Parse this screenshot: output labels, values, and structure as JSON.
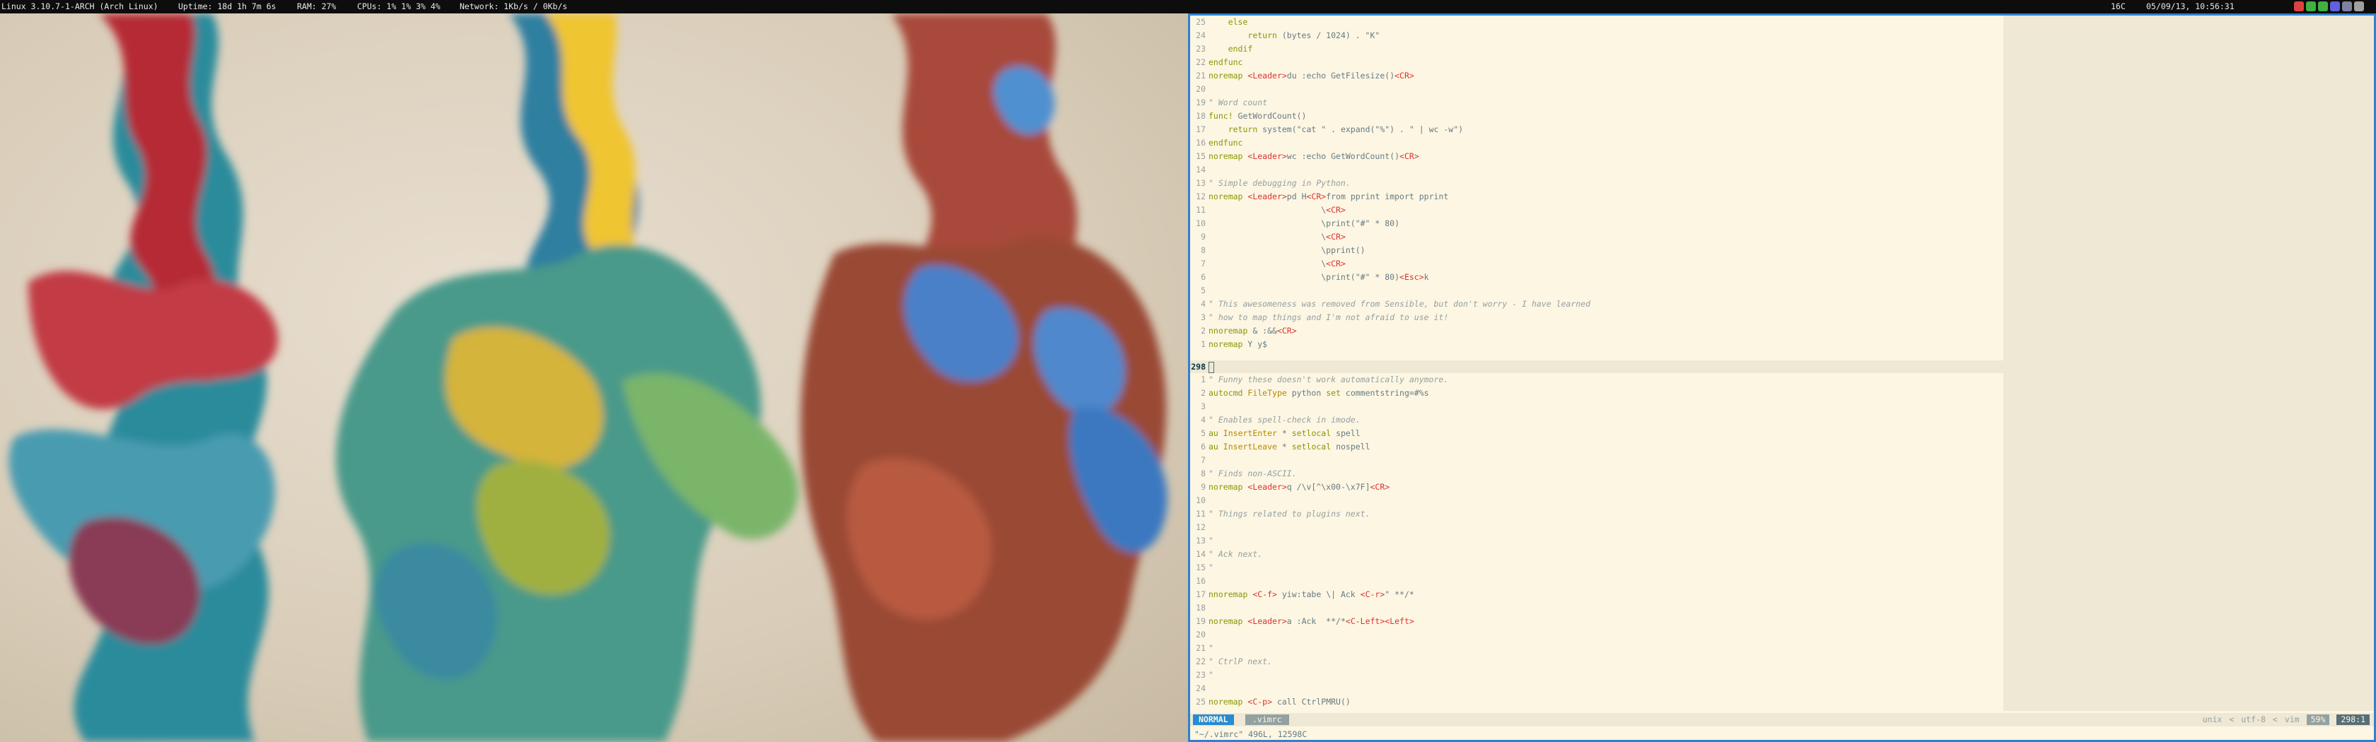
{
  "topbar": {
    "kernel": "Linux 3.10.7-1-ARCH (Arch Linux)",
    "uptime": "Uptime: 18d 1h 7m 6s",
    "ram": "RAM: 27%",
    "cpus": "CPUs: 1% 1% 3% 4%",
    "network": "Network: 1Kb/s / 0Kb/s",
    "temperature": "16C",
    "datetime": "05/09/13, 10:56:31",
    "tray_colors": [
      "#e04040",
      "#40b040",
      "#40b040",
      "#6060e0",
      "#8080a0",
      "#a0a0a0"
    ]
  },
  "editor": {
    "top_lines": [
      {
        "n": "25",
        "text": "    else"
      },
      {
        "n": "24",
        "text": "        return (bytes / 1024) . \"K\""
      },
      {
        "n": "23",
        "text": "    endif"
      },
      {
        "n": "22",
        "text": "endfunc"
      },
      {
        "n": "21",
        "text": "noremap <Leader>du :echo GetFilesize()<CR>"
      },
      {
        "n": "20",
        "text": ""
      },
      {
        "n": "19",
        "text": "\" Word count"
      },
      {
        "n": "18",
        "text": "func! GetWordCount()"
      },
      {
        "n": "17",
        "text": "    return system(\"cat \" . expand(\"%\") . \" | wc -w\")"
      },
      {
        "n": "16",
        "text": "endfunc"
      },
      {
        "n": "15",
        "text": "noremap <Leader>wc :echo GetWordCount()<CR>"
      },
      {
        "n": "14",
        "text": ""
      },
      {
        "n": "13",
        "text": "\" Simple debugging in Python."
      },
      {
        "n": "12",
        "text": "noremap <Leader>pd H<CR>from pprint import pprint"
      },
      {
        "n": "11",
        "text": "                       \\<CR>"
      },
      {
        "n": "10",
        "text": "                       \\print(\"#\" * 80)"
      },
      {
        "n": "9",
        "text": "                       \\<CR>"
      },
      {
        "n": "8",
        "text": "                       \\pprint()"
      },
      {
        "n": "7",
        "text": "                       \\<CR>"
      },
      {
        "n": "6",
        "text": "                       \\print(\"#\" * 80)<Esc>k"
      },
      {
        "n": "5",
        "text": ""
      },
      {
        "n": "4",
        "text": "\" This awesomeness was removed from Sensible, but don't worry - I have learned"
      },
      {
        "n": "3",
        "text": "\" how to map things and I'm not afraid to use it!"
      },
      {
        "n": "2",
        "text": "nnoremap & :&&<CR>"
      },
      {
        "n": "1",
        "text": "noremap Y y$"
      }
    ],
    "current_line_number": "298",
    "bottom_lines": [
      {
        "n": "1",
        "text": "\" Funny these doesn't work automatically anymore."
      },
      {
        "n": "2",
        "text": "autocmd FileType python set commentstring=#%s"
      },
      {
        "n": "3",
        "text": ""
      },
      {
        "n": "4",
        "text": "\" Enables spell-check in imode."
      },
      {
        "n": "5",
        "text": "au InsertEnter * setlocal spell"
      },
      {
        "n": "6",
        "text": "au InsertLeave * setlocal nospell"
      },
      {
        "n": "7",
        "text": ""
      },
      {
        "n": "8",
        "text": "\" Finds non-ASCII."
      },
      {
        "n": "9",
        "text": "noremap <Leader>q /\\v[^\\x00-\\x7F]<CR>"
      },
      {
        "n": "10",
        "text": ""
      },
      {
        "n": "11",
        "text": "\" Things related to plugins next."
      },
      {
        "n": "12",
        "text": ""
      },
      {
        "n": "13",
        "text": "\""
      },
      {
        "n": "14",
        "text": "\" Ack next."
      },
      {
        "n": "15",
        "text": "\""
      },
      {
        "n": "16",
        "text": ""
      },
      {
        "n": "17",
        "text": "nnoremap <C-f> yiw:tabe \\| Ack <C-r>\" **/*"
      },
      {
        "n": "18",
        "text": ""
      },
      {
        "n": "19",
        "text": "noremap <Leader>a :Ack  **/*<C-Left><Left>"
      },
      {
        "n": "20",
        "text": ""
      },
      {
        "n": "21",
        "text": "\""
      },
      {
        "n": "22",
        "text": "\" CtrlP next."
      },
      {
        "n": "23",
        "text": "\""
      },
      {
        "n": "24",
        "text": ""
      },
      {
        "n": "25",
        "text": "noremap <C-p> call CtrlPMRU()"
      }
    ],
    "statusline": {
      "mode": "NORMAL",
      "filename": ".vimrc",
      "fileformat": "unix",
      "encoding": "utf-8",
      "filetype": "vim",
      "percent": "59%",
      "position": "298:1"
    },
    "cmdline": "\"~/.vimrc\" 496L, 12598C"
  }
}
